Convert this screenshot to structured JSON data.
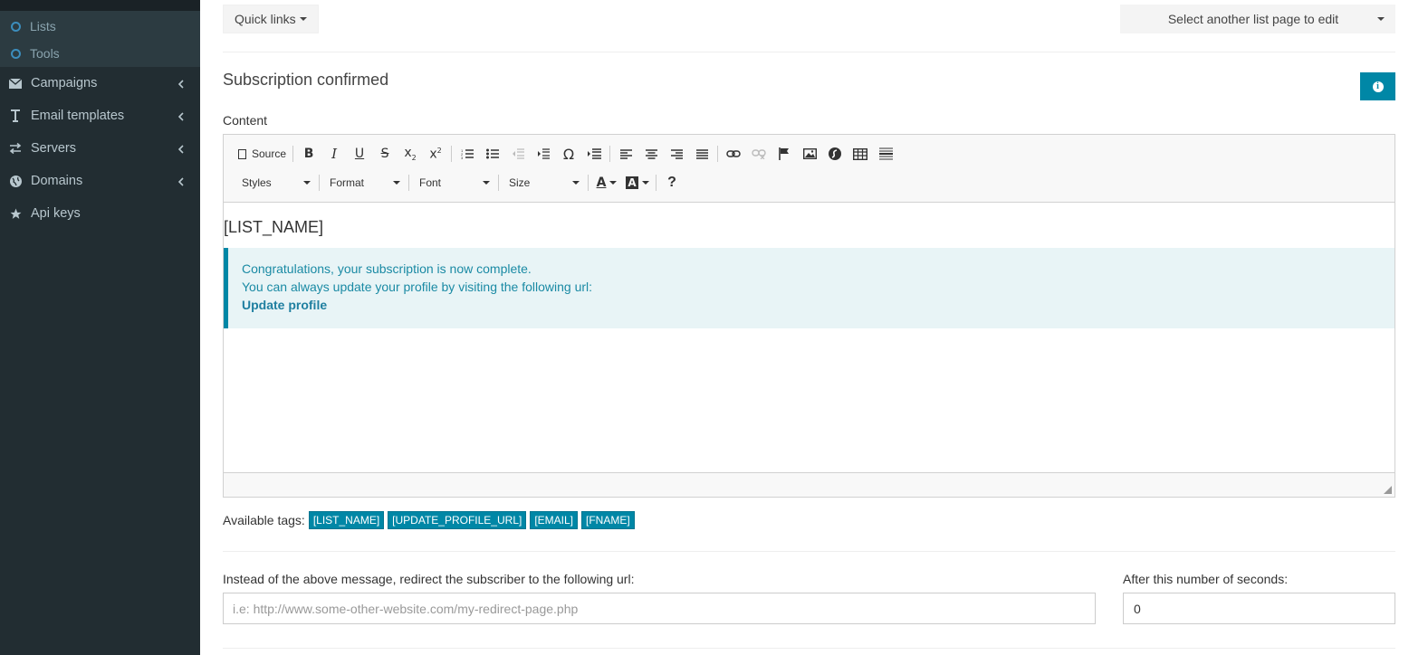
{
  "sidebar": {
    "sub_items": [
      {
        "label": "Lists",
        "icon": "circle-icon"
      },
      {
        "label": "Tools",
        "icon": "circle-icon"
      }
    ],
    "items": [
      {
        "label": "Campaigns",
        "icon": "envelope-icon"
      },
      {
        "label": "Email templates",
        "icon": "text-icon"
      },
      {
        "label": "Servers",
        "icon": "exchange-icon"
      },
      {
        "label": "Domains",
        "icon": "globe-icon"
      },
      {
        "label": "Api keys",
        "icon": "star-icon"
      }
    ]
  },
  "header": {
    "quick_links": "Quick links",
    "select_list_page": "Select another list page to edit"
  },
  "page": {
    "title": "Subscription confirmed",
    "content_label": "Content"
  },
  "editor": {
    "toolbar": {
      "source": "Source",
      "styles": "Styles",
      "format": "Format",
      "font": "Font",
      "size": "Size",
      "help": "?"
    },
    "body": {
      "heading": "[LIST_NAME]",
      "line1": "Congratulations, your subscription is now complete.",
      "line2": "You can always update your profile by visiting the following url:",
      "link": "Update profile"
    }
  },
  "tags": {
    "label": "Available tags:",
    "items": [
      "[LIST_NAME]",
      "[UPDATE_PROFILE_URL]",
      "[EMAIL]",
      "[FNAME]"
    ]
  },
  "redirect": {
    "label": "Instead of the above message, redirect the subscriber to the following url:",
    "placeholder": "i.e: http://www.some-other-website.com/my-redirect-page.php",
    "seconds_label": "After this number of seconds:",
    "seconds_value": "0"
  },
  "colors": {
    "sidebar_bg": "#222d32",
    "accent": "#0087a6",
    "callout_bg": "#e8f4f6"
  }
}
